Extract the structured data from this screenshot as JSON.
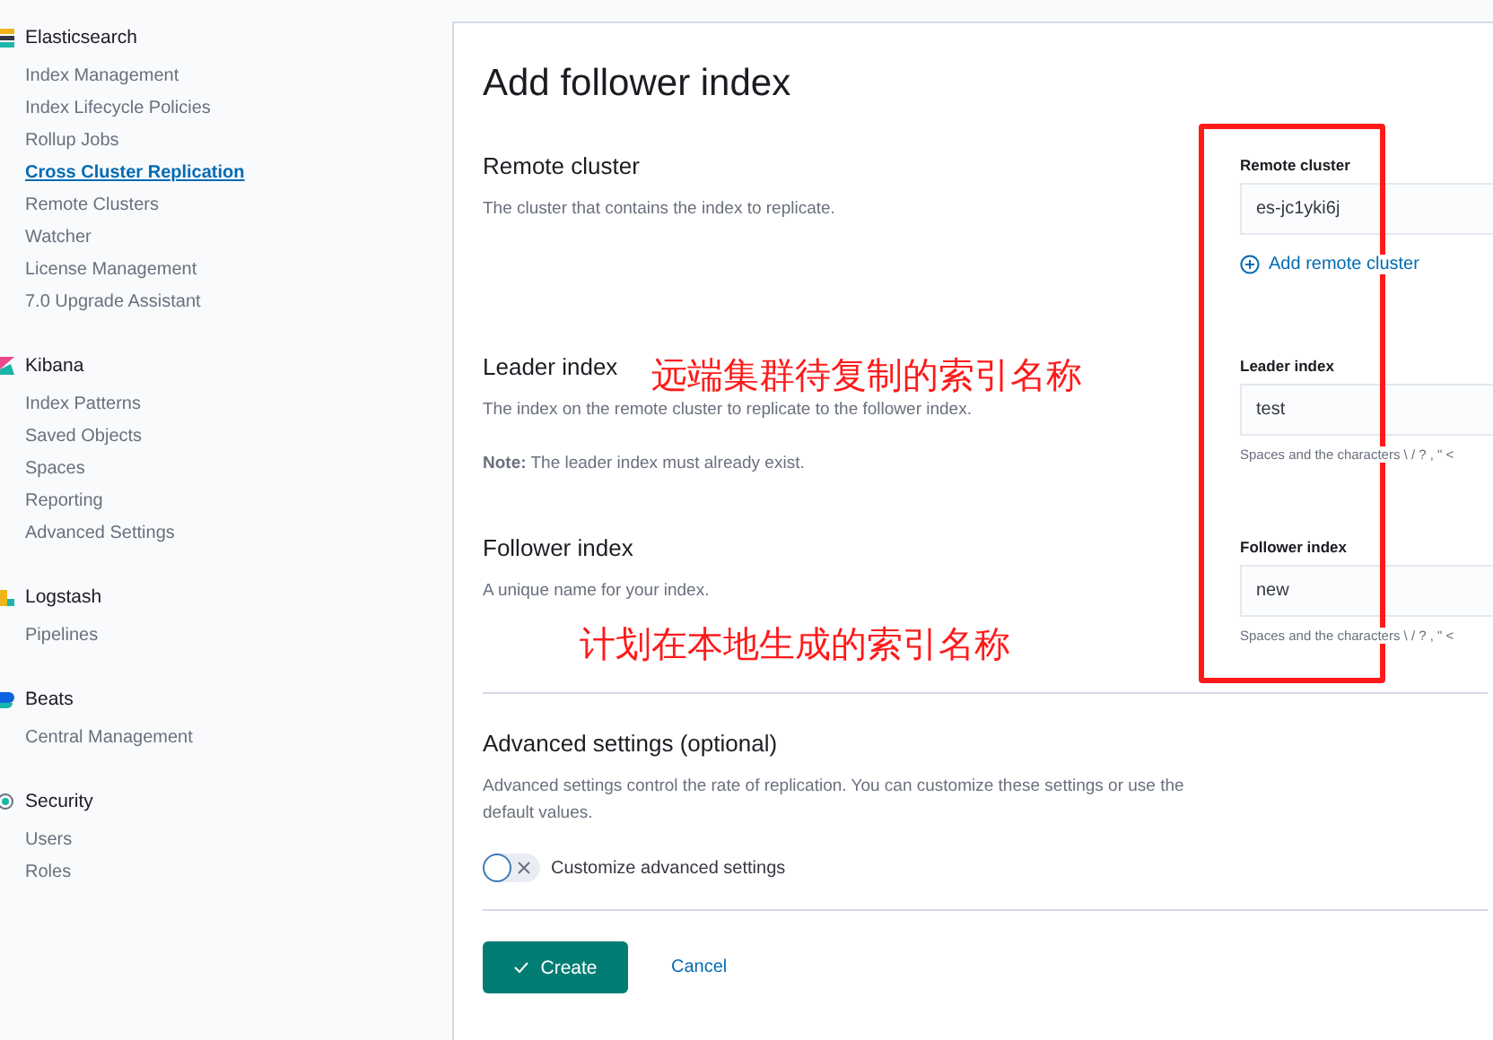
{
  "sidebar": {
    "groups": [
      {
        "title": "Elasticsearch",
        "kind": "elasticsearch",
        "items": [
          {
            "label": "Index Management",
            "selected": false
          },
          {
            "label": "Index Lifecycle Policies",
            "selected": false
          },
          {
            "label": "Rollup Jobs",
            "selected": false
          },
          {
            "label": "Cross Cluster Replication",
            "selected": true
          },
          {
            "label": "Remote Clusters",
            "selected": false
          },
          {
            "label": "Watcher",
            "selected": false
          },
          {
            "label": "License Management",
            "selected": false
          },
          {
            "label": "7.0 Upgrade Assistant",
            "selected": false
          }
        ]
      },
      {
        "title": "Kibana",
        "kind": "kibana",
        "items": [
          {
            "label": "Index Patterns",
            "selected": false
          },
          {
            "label": "Saved Objects",
            "selected": false
          },
          {
            "label": "Spaces",
            "selected": false
          },
          {
            "label": "Reporting",
            "selected": false
          },
          {
            "label": "Advanced Settings",
            "selected": false
          }
        ]
      },
      {
        "title": "Logstash",
        "kind": "logstash",
        "items": [
          {
            "label": "Pipelines",
            "selected": false
          }
        ]
      },
      {
        "title": "Beats",
        "kind": "beats",
        "items": [
          {
            "label": "Central Management",
            "selected": false
          }
        ]
      },
      {
        "title": "Security",
        "kind": "security",
        "items": [
          {
            "label": "Users",
            "selected": false
          },
          {
            "label": "Roles",
            "selected": false
          }
        ]
      }
    ]
  },
  "page": {
    "title": "Add follower index",
    "sections": [
      {
        "title": "Remote cluster",
        "description": "The cluster that contains the index to replicate.",
        "field_label": "Remote cluster",
        "value": "es-jc1yki6j",
        "link": "Add remote cluster"
      },
      {
        "title": "Leader index",
        "description": "The index on the remote cluster to replicate to the follower index.",
        "note": "**Note:** The leader index must already exist.",
        "field_label": "Leader index",
        "value": "test",
        "help": "Spaces and the characters \\ / ? , \" <"
      },
      {
        "title": "Follower index",
        "description": "A unique name for your index.",
        "field_label": "Follower index",
        "value": "new",
        "help": "Spaces and the characters \\ / ? , \" <"
      }
    ],
    "advanced": {
      "title": "Advanced settings (optional)",
      "description": "Advanced settings control the rate of replication. You can customize these settings or use the default values.",
      "toggle_label": "Customize advanced settings",
      "on": false
    },
    "buttons": {
      "create": "Create",
      "cancel": "Cancel"
    }
  },
  "annotations": [
    "远端集群待复制的索引名称",
    "计划在本地生成的索引名称"
  ]
}
